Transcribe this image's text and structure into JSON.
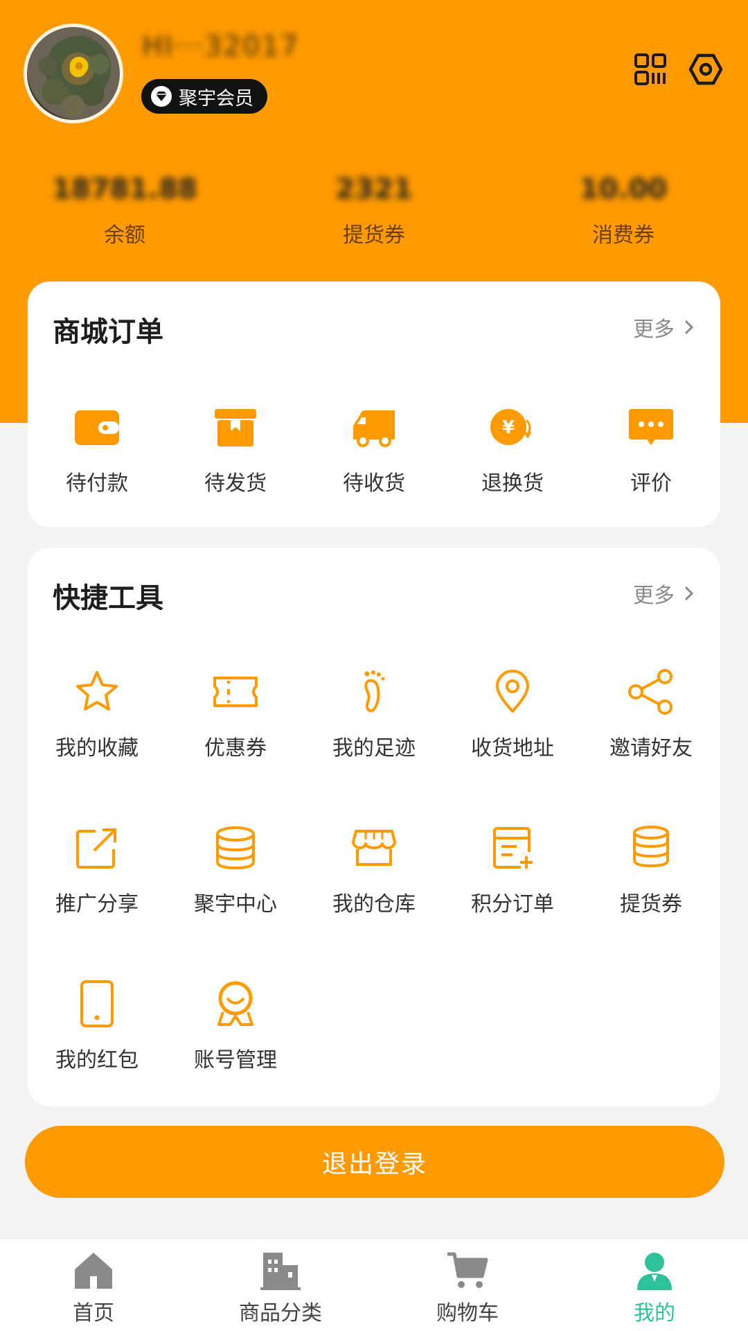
{
  "colors": {
    "brand": "#ff9a00",
    "active_tab": "#2fc19a"
  },
  "profile": {
    "username": "HI···32017",
    "member_badge": "聚宇会员",
    "qr_icon": "qr-code-icon",
    "settings_icon": "settings-hexagon-icon"
  },
  "stats": [
    {
      "value": "18781.88",
      "label": "余额"
    },
    {
      "value": "2321",
      "label": "提货券"
    },
    {
      "value": "10.00",
      "label": "消费券"
    }
  ],
  "orders": {
    "title": "商城订单",
    "more": "更多",
    "items": [
      {
        "label": "待付款",
        "icon": "wallet-icon"
      },
      {
        "label": "待发货",
        "icon": "box-icon"
      },
      {
        "label": "待收货",
        "icon": "truck-icon"
      },
      {
        "label": "退换货",
        "icon": "refund-icon"
      },
      {
        "label": "评价",
        "icon": "comment-icon"
      }
    ]
  },
  "tools": {
    "title": "快捷工具",
    "more": "更多",
    "items": [
      {
        "label": "我的收藏",
        "icon": "star-icon"
      },
      {
        "label": "优惠券",
        "icon": "ticket-icon"
      },
      {
        "label": "我的足迹",
        "icon": "footprint-icon"
      },
      {
        "label": "收货地址",
        "icon": "location-icon"
      },
      {
        "label": "邀请好友",
        "icon": "share-icon"
      },
      {
        "label": "推广分享",
        "icon": "external-share-icon"
      },
      {
        "label": "聚宇中心",
        "icon": "database-icon"
      },
      {
        "label": "我的仓库",
        "icon": "store-icon"
      },
      {
        "label": "积分订单",
        "icon": "points-order-icon"
      },
      {
        "label": "提货券",
        "icon": "coins-icon"
      },
      {
        "label": "我的红包",
        "icon": "tablet-icon"
      },
      {
        "label": "账号管理",
        "icon": "account-icon"
      }
    ]
  },
  "logout": "退出登录",
  "tabbar": [
    {
      "label": "首页",
      "icon": "home-icon",
      "active": false
    },
    {
      "label": "商品分类",
      "icon": "category-icon",
      "active": false
    },
    {
      "label": "购物车",
      "icon": "cart-icon",
      "active": false
    },
    {
      "label": "我的",
      "icon": "user-icon",
      "active": true
    }
  ]
}
